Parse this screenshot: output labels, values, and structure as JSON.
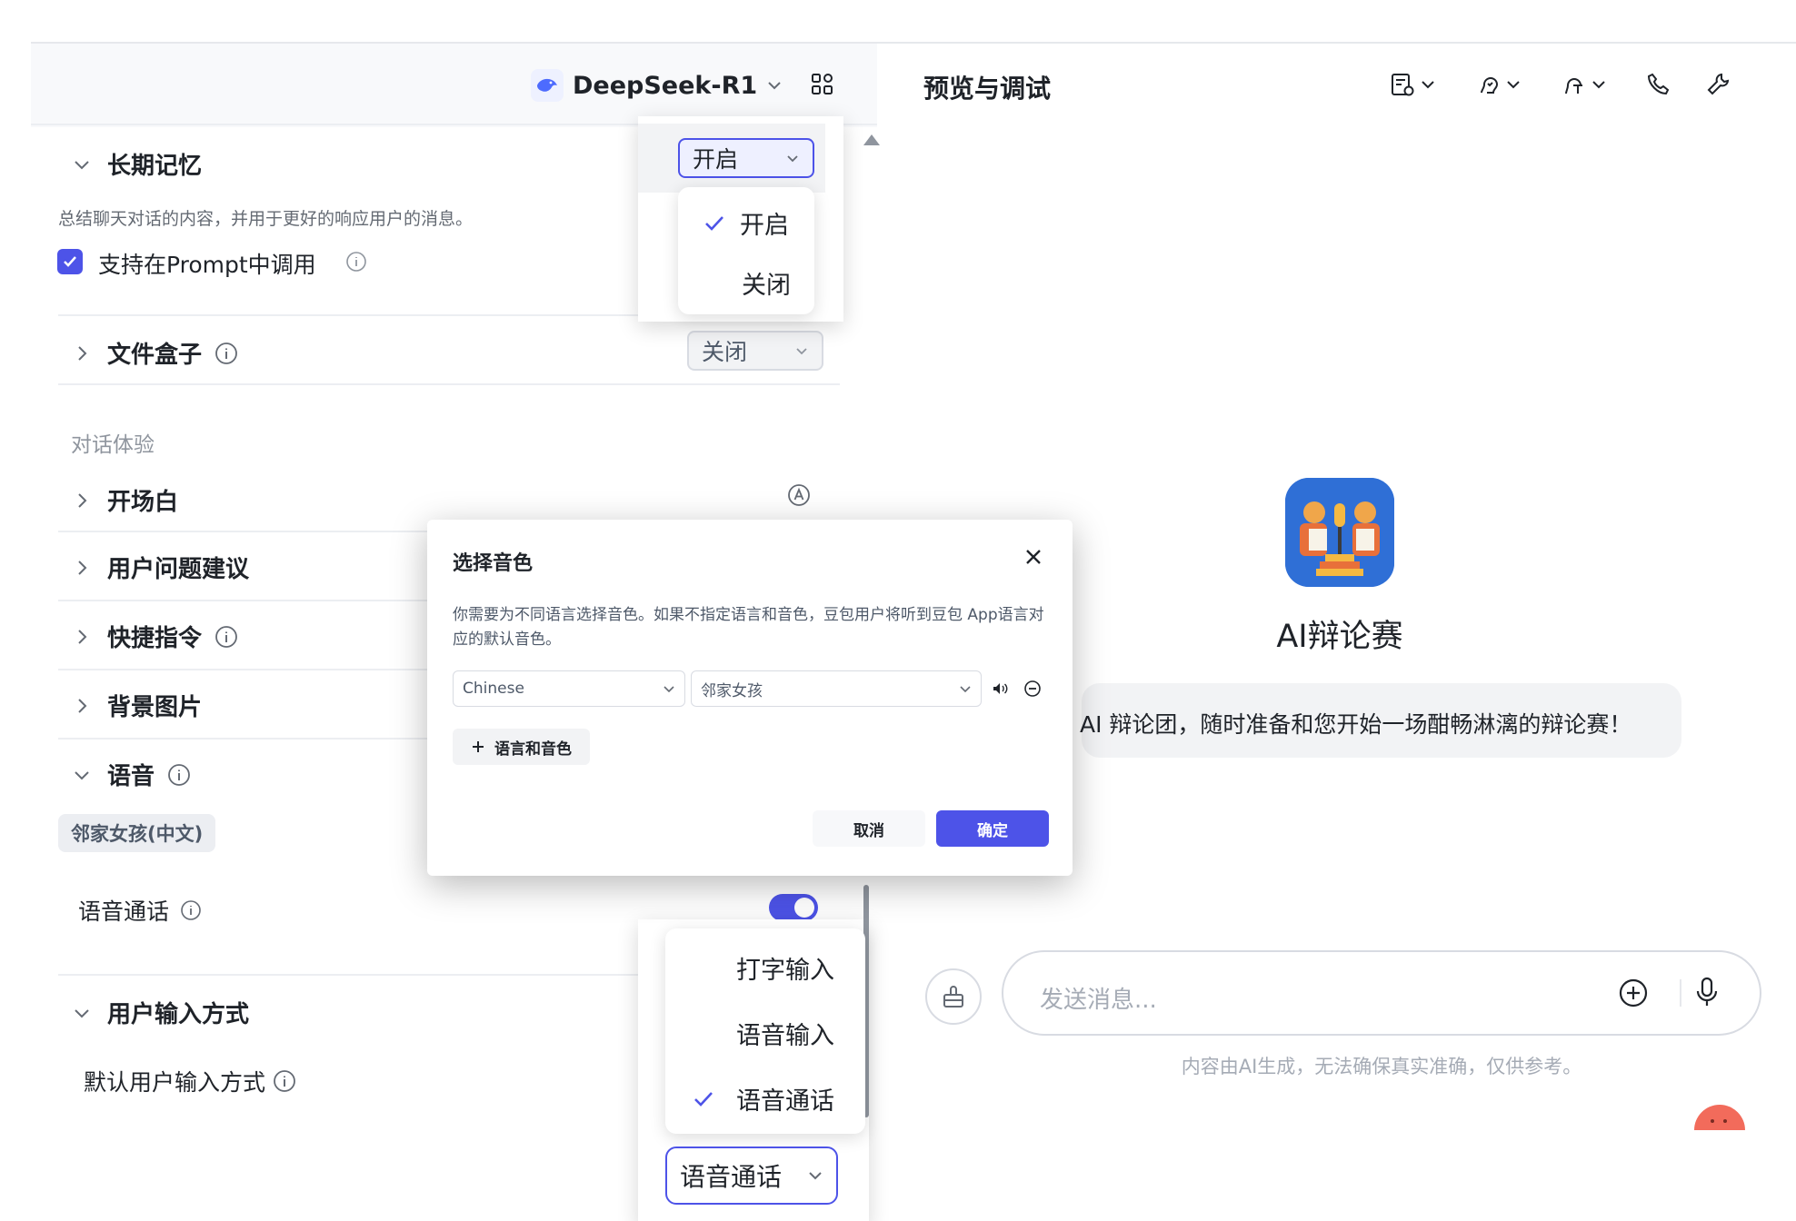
{
  "model": {
    "name": "DeepSeek-R1"
  },
  "left": {
    "long_memory": {
      "title": "长期记忆",
      "value": "开启",
      "desc": "总结聊天对话的内容，并用于更好的响应用户的消息。",
      "prompt_checkbox_label": "支持在Prompt中调用",
      "prompt_checkbox_checked": true
    },
    "file_box": {
      "title": "文件盒子",
      "value": "关闭"
    },
    "dialog_experience_label": "对话体验",
    "opening": {
      "title": "开场白"
    },
    "suggestions": {
      "title": "用户问题建议"
    },
    "shortcuts": {
      "title": "快捷指令"
    },
    "background": {
      "title": "背景图片"
    },
    "voice": {
      "title": "语音",
      "tag": "邻家女孩(中文)",
      "call_label": "语音通话",
      "call_enabled": true
    },
    "user_input": {
      "title": "用户输入方式",
      "default_label": "默认用户输入方式",
      "value": "语音通话"
    }
  },
  "memory_dropdown": {
    "options": [
      {
        "label": "开启",
        "selected": true
      },
      {
        "label": "关闭",
        "selected": false
      }
    ]
  },
  "input_dropdown": {
    "options": [
      {
        "label": "打字输入",
        "selected": false
      },
      {
        "label": "语音输入",
        "selected": false
      },
      {
        "label": "语音通话",
        "selected": true
      }
    ]
  },
  "modal": {
    "title": "选择音色",
    "desc": "你需要为不同语言选择音色。如果不指定语言和音色，豆包用户将听到豆包 App语言对应的默认音色。",
    "language": "Chinese",
    "voice": "邻家女孩",
    "add_label": "语言和音色",
    "cancel": "取消",
    "confirm": "确定"
  },
  "right": {
    "title": "预览与调试",
    "bot_name": "AI辩论赛",
    "greeting": "AI 辩论团，随时准备和您开始一场酣畅淋漓的辩论赛！",
    "input_placeholder": "发送消息...",
    "disclaimer": "内容由AI生成，无法确保真实准确，仅供参考。"
  },
  "colors": {
    "accent": "#4d53e8",
    "bot_avatar_bg": "#2f6fd6",
    "mascot": "#f26b5b"
  },
  "icons": [
    "chevron-down-icon",
    "chevron-right-icon",
    "info-icon",
    "grid-icon",
    "close-icon",
    "speaker-icon",
    "minus-circle-icon",
    "plus-icon",
    "check-icon",
    "plus-circle-icon",
    "mic-icon",
    "phone-icon",
    "wrench-icon",
    "clear-context-icon",
    "layout-icon",
    "mic-settings-icon",
    "voice-icon"
  ]
}
